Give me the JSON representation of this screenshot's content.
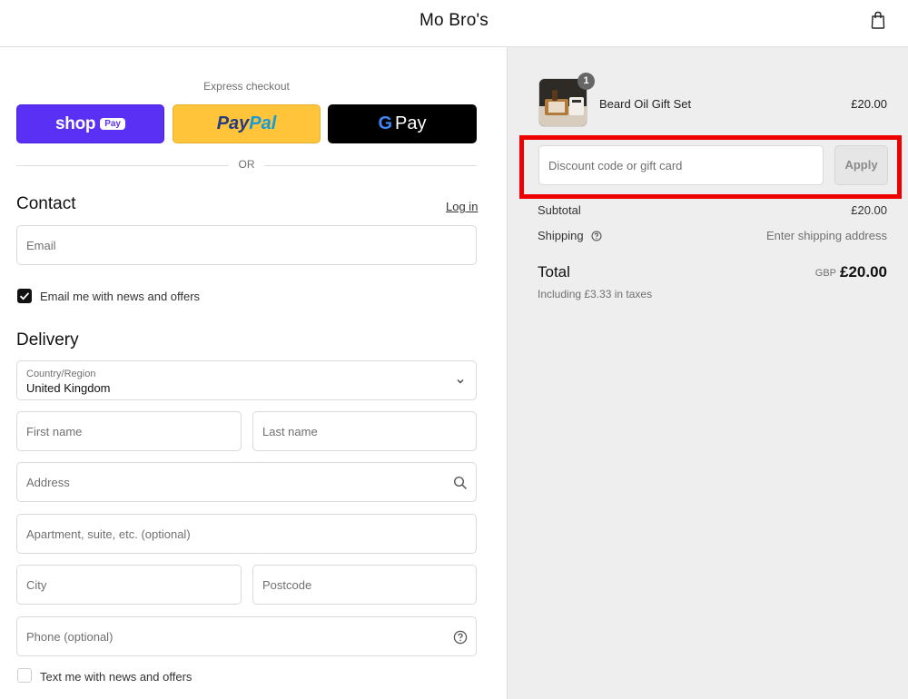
{
  "header": {
    "store_name": "Mo Bro's",
    "cart_icon": "shopping-bag-icon"
  },
  "express": {
    "label": "Express checkout",
    "shop_pay": {
      "word": "shop",
      "pill": "Pay",
      "color": "#5a31f4"
    },
    "paypal": {
      "pay": "Pay",
      "pal": "Pal",
      "color": "#ffc439"
    },
    "gpay": {
      "g": "G",
      "pay": "Pay",
      "color": "#000000"
    },
    "divider": "OR"
  },
  "contact": {
    "title": "Contact",
    "login_link": "Log in",
    "email_placeholder": "Email",
    "news_checkbox": {
      "label": "Email me with news and offers",
      "checked": true
    }
  },
  "delivery": {
    "title": "Delivery",
    "country_label": "Country/Region",
    "country_value": "United Kingdom",
    "first_name": "First name",
    "last_name": "Last name",
    "address": "Address",
    "apartment": "Apartment, suite, etc. (optional)",
    "city": "City",
    "postcode": "Postcode",
    "phone": "Phone (optional)",
    "sms_checkbox": {
      "label": "Text me with news and offers",
      "checked": false
    }
  },
  "summary": {
    "item": {
      "name": "Beard Oil Gift Set",
      "price": "£20.00",
      "quantity": "1"
    },
    "discount_placeholder": "Discount code or gift card",
    "apply_label": "Apply",
    "subtotal_label": "Subtotal",
    "subtotal_value": "£20.00",
    "shipping_label": "Shipping",
    "shipping_value": "Enter shipping address",
    "total_label": "Total",
    "currency": "GBP",
    "total_value": "£20.00",
    "tax_note": "Including £3.33 in taxes"
  },
  "colors": {
    "highlight": "#ee0000",
    "right_panel_bg": "#eeeeee"
  }
}
